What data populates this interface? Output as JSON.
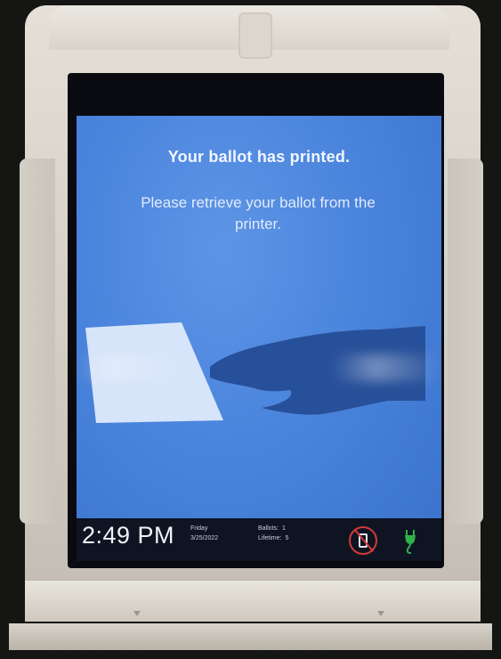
{
  "screen": {
    "headline": "Your ballot has printed.",
    "instruction": "Please retrieve your ballot from the printer."
  },
  "status_bar": {
    "time": "2:49 PM",
    "day": "Friday",
    "date": "3/25/2022",
    "ballots_label": "Ballots:",
    "ballots_value": "1",
    "lifetime_label": "Lifetime:",
    "lifetime_value": "5"
  },
  "icons": {
    "battery": "battery-unavailable-icon",
    "power": "power-plug-icon"
  },
  "colors": {
    "screen_blue": "#4a84dc",
    "status_bar": "#0e1422",
    "battery_alert": "#d23a3a",
    "plug_green": "#2fb04a"
  }
}
